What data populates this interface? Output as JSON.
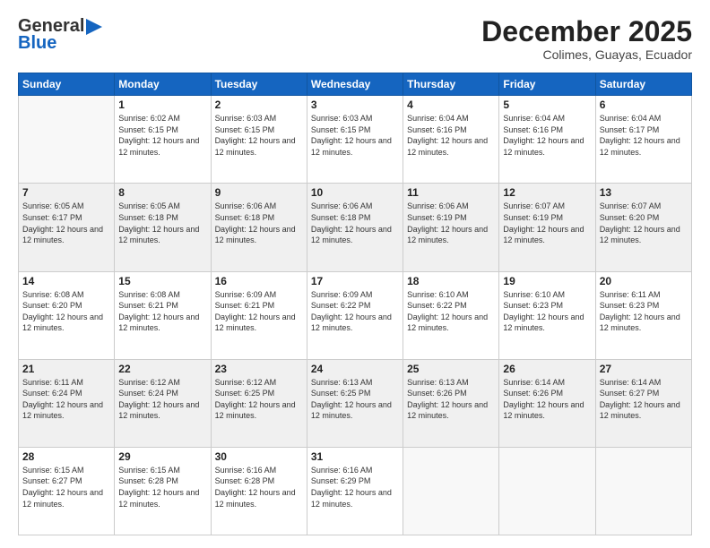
{
  "logo": {
    "line1": "General",
    "line2": "Blue"
  },
  "header": {
    "month": "December 2025",
    "location": "Colimes, Guayas, Ecuador"
  },
  "weekdays": [
    "Sunday",
    "Monday",
    "Tuesday",
    "Wednesday",
    "Thursday",
    "Friday",
    "Saturday"
  ],
  "weeks": [
    [
      {
        "day": "",
        "sunrise": "",
        "sunset": "",
        "daylight": ""
      },
      {
        "day": "1",
        "sunrise": "Sunrise: 6:02 AM",
        "sunset": "Sunset: 6:15 PM",
        "daylight": "Daylight: 12 hours and 12 minutes."
      },
      {
        "day": "2",
        "sunrise": "Sunrise: 6:03 AM",
        "sunset": "Sunset: 6:15 PM",
        "daylight": "Daylight: 12 hours and 12 minutes."
      },
      {
        "day": "3",
        "sunrise": "Sunrise: 6:03 AM",
        "sunset": "Sunset: 6:15 PM",
        "daylight": "Daylight: 12 hours and 12 minutes."
      },
      {
        "day": "4",
        "sunrise": "Sunrise: 6:04 AM",
        "sunset": "Sunset: 6:16 PM",
        "daylight": "Daylight: 12 hours and 12 minutes."
      },
      {
        "day": "5",
        "sunrise": "Sunrise: 6:04 AM",
        "sunset": "Sunset: 6:16 PM",
        "daylight": "Daylight: 12 hours and 12 minutes."
      },
      {
        "day": "6",
        "sunrise": "Sunrise: 6:04 AM",
        "sunset": "Sunset: 6:17 PM",
        "daylight": "Daylight: 12 hours and 12 minutes."
      }
    ],
    [
      {
        "day": "7",
        "sunrise": "Sunrise: 6:05 AM",
        "sunset": "Sunset: 6:17 PM",
        "daylight": "Daylight: 12 hours and 12 minutes."
      },
      {
        "day": "8",
        "sunrise": "Sunrise: 6:05 AM",
        "sunset": "Sunset: 6:18 PM",
        "daylight": "Daylight: 12 hours and 12 minutes."
      },
      {
        "day": "9",
        "sunrise": "Sunrise: 6:06 AM",
        "sunset": "Sunset: 6:18 PM",
        "daylight": "Daylight: 12 hours and 12 minutes."
      },
      {
        "day": "10",
        "sunrise": "Sunrise: 6:06 AM",
        "sunset": "Sunset: 6:18 PM",
        "daylight": "Daylight: 12 hours and 12 minutes."
      },
      {
        "day": "11",
        "sunrise": "Sunrise: 6:06 AM",
        "sunset": "Sunset: 6:19 PM",
        "daylight": "Daylight: 12 hours and 12 minutes."
      },
      {
        "day": "12",
        "sunrise": "Sunrise: 6:07 AM",
        "sunset": "Sunset: 6:19 PM",
        "daylight": "Daylight: 12 hours and 12 minutes."
      },
      {
        "day": "13",
        "sunrise": "Sunrise: 6:07 AM",
        "sunset": "Sunset: 6:20 PM",
        "daylight": "Daylight: 12 hours and 12 minutes."
      }
    ],
    [
      {
        "day": "14",
        "sunrise": "Sunrise: 6:08 AM",
        "sunset": "Sunset: 6:20 PM",
        "daylight": "Daylight: 12 hours and 12 minutes."
      },
      {
        "day": "15",
        "sunrise": "Sunrise: 6:08 AM",
        "sunset": "Sunset: 6:21 PM",
        "daylight": "Daylight: 12 hours and 12 minutes."
      },
      {
        "day": "16",
        "sunrise": "Sunrise: 6:09 AM",
        "sunset": "Sunset: 6:21 PM",
        "daylight": "Daylight: 12 hours and 12 minutes."
      },
      {
        "day": "17",
        "sunrise": "Sunrise: 6:09 AM",
        "sunset": "Sunset: 6:22 PM",
        "daylight": "Daylight: 12 hours and 12 minutes."
      },
      {
        "day": "18",
        "sunrise": "Sunrise: 6:10 AM",
        "sunset": "Sunset: 6:22 PM",
        "daylight": "Daylight: 12 hours and 12 minutes."
      },
      {
        "day": "19",
        "sunrise": "Sunrise: 6:10 AM",
        "sunset": "Sunset: 6:23 PM",
        "daylight": "Daylight: 12 hours and 12 minutes."
      },
      {
        "day": "20",
        "sunrise": "Sunrise: 6:11 AM",
        "sunset": "Sunset: 6:23 PM",
        "daylight": "Daylight: 12 hours and 12 minutes."
      }
    ],
    [
      {
        "day": "21",
        "sunrise": "Sunrise: 6:11 AM",
        "sunset": "Sunset: 6:24 PM",
        "daylight": "Daylight: 12 hours and 12 minutes."
      },
      {
        "day": "22",
        "sunrise": "Sunrise: 6:12 AM",
        "sunset": "Sunset: 6:24 PM",
        "daylight": "Daylight: 12 hours and 12 minutes."
      },
      {
        "day": "23",
        "sunrise": "Sunrise: 6:12 AM",
        "sunset": "Sunset: 6:25 PM",
        "daylight": "Daylight: 12 hours and 12 minutes."
      },
      {
        "day": "24",
        "sunrise": "Sunrise: 6:13 AM",
        "sunset": "Sunset: 6:25 PM",
        "daylight": "Daylight: 12 hours and 12 minutes."
      },
      {
        "day": "25",
        "sunrise": "Sunrise: 6:13 AM",
        "sunset": "Sunset: 6:26 PM",
        "daylight": "Daylight: 12 hours and 12 minutes."
      },
      {
        "day": "26",
        "sunrise": "Sunrise: 6:14 AM",
        "sunset": "Sunset: 6:26 PM",
        "daylight": "Daylight: 12 hours and 12 minutes."
      },
      {
        "day": "27",
        "sunrise": "Sunrise: 6:14 AM",
        "sunset": "Sunset: 6:27 PM",
        "daylight": "Daylight: 12 hours and 12 minutes."
      }
    ],
    [
      {
        "day": "28",
        "sunrise": "Sunrise: 6:15 AM",
        "sunset": "Sunset: 6:27 PM",
        "daylight": "Daylight: 12 hours and 12 minutes."
      },
      {
        "day": "29",
        "sunrise": "Sunrise: 6:15 AM",
        "sunset": "Sunset: 6:28 PM",
        "daylight": "Daylight: 12 hours and 12 minutes."
      },
      {
        "day": "30",
        "sunrise": "Sunrise: 6:16 AM",
        "sunset": "Sunset: 6:28 PM",
        "daylight": "Daylight: 12 hours and 12 minutes."
      },
      {
        "day": "31",
        "sunrise": "Sunrise: 6:16 AM",
        "sunset": "Sunset: 6:29 PM",
        "daylight": "Daylight: 12 hours and 12 minutes."
      },
      {
        "day": "",
        "sunrise": "",
        "sunset": "",
        "daylight": ""
      },
      {
        "day": "",
        "sunrise": "",
        "sunset": "",
        "daylight": ""
      },
      {
        "day": "",
        "sunrise": "",
        "sunset": "",
        "daylight": ""
      }
    ]
  ]
}
